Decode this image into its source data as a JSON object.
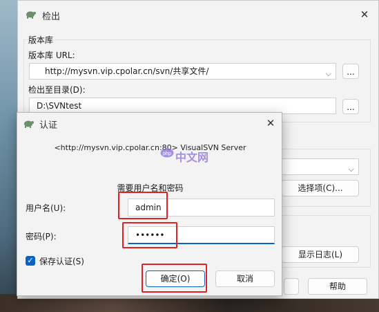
{
  "main_window": {
    "title": "检出",
    "group_label": "版本库",
    "repo_url_label": "版本库 URL:",
    "repo_url_value": "http://mysvn.vip.cpolar.cn/svn/共享文件/",
    "browse_label": "...",
    "checkout_dir_label": "检出至目录(D):",
    "checkout_dir_value": "D:\\SVNtest",
    "browse2_label": "...",
    "options_button": "选择项(C)...",
    "show_log_button": "显示日志(L)",
    "help_button": "帮助"
  },
  "auth_dialog": {
    "title": "认证",
    "server_line": "<http://mysvn.vip.cpolar.cn:80> VisualSVN Server",
    "prompt": "需要用户名和密码",
    "username_label": "用户名(U):",
    "username_value": "admin",
    "password_label": "密码(P):",
    "password_value": "••••••",
    "save_auth_label": "保存认证(S)",
    "ok_button": "确定(O)",
    "cancel_button": "取消"
  },
  "watermark": {
    "text": "中文网"
  },
  "colors": {
    "accent": "#0a64c2",
    "highlight": "#e12121",
    "window_bg": "#f3f3f3"
  }
}
